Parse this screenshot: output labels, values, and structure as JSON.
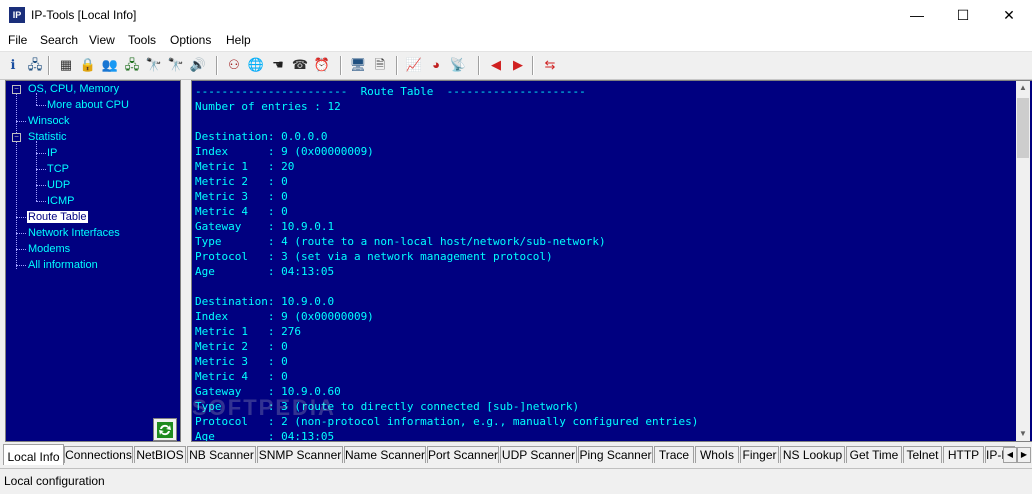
{
  "window": {
    "title": "IP-Tools [Local Info]",
    "icon_text": "IP",
    "minimize_icon": "—",
    "maximize_icon": "☐",
    "close_icon": "✕"
  },
  "menu": [
    "File",
    "Search",
    "View",
    "Tools",
    "Options",
    "Help"
  ],
  "toolbar": {
    "icons": [
      {
        "name": "info-icon",
        "glyph": "ℹ",
        "color": "#1a4ea0"
      },
      {
        "name": "computer-network-icon",
        "glyph": "🖧",
        "color": "#205080"
      },
      {
        "name": "calculator-icon",
        "glyph": "▦",
        "color": "#303030"
      },
      {
        "name": "lock-icon",
        "glyph": "🔒",
        "color": "#806000"
      },
      {
        "name": "users-icon",
        "glyph": "👥",
        "color": "#205080"
      },
      {
        "name": "network-tree-icon",
        "glyph": "🖧",
        "color": "#207020"
      },
      {
        "name": "binoculars-icon",
        "glyph": "🔭",
        "color": "#202020"
      },
      {
        "name": "binoculars-blue-icon",
        "glyph": "🔭",
        "color": "#2030a0"
      },
      {
        "name": "speaker-icon",
        "glyph": "🔊",
        "color": "#806000"
      },
      {
        "name": "network-people-icon",
        "glyph": "⚇",
        "color": "#a02020"
      },
      {
        "name": "globe-icon",
        "glyph": "🌐",
        "color": "#207050"
      },
      {
        "name": "finger-icon",
        "glyph": "☚",
        "color": "#202020"
      },
      {
        "name": "phone-icon",
        "glyph": "☎",
        "color": "#303030"
      },
      {
        "name": "alarm-clock-icon",
        "glyph": "⏰",
        "color": "#c02020"
      },
      {
        "name": "monitor-icon",
        "glyph": "🖥",
        "color": "#205080"
      },
      {
        "name": "document-icon",
        "glyph": "🗎",
        "color": "#404040"
      },
      {
        "name": "chart-icon",
        "glyph": "📈",
        "color": "#a02060"
      },
      {
        "name": "pie-chart-icon",
        "glyph": "◕",
        "color": "#c02020"
      },
      {
        "name": "satellite-dish-icon",
        "glyph": "📡",
        "color": "#606060"
      },
      {
        "name": "arrow-left-icon",
        "glyph": "◀",
        "color": "#d02020"
      },
      {
        "name": "arrow-right-icon",
        "glyph": "▶",
        "color": "#d02020"
      },
      {
        "name": "arrows-swap-icon",
        "glyph": "⇆",
        "color": "#d02020"
      }
    ]
  },
  "tree": [
    {
      "label": "OS, CPU, Memory",
      "expander": "−"
    },
    {
      "label": "More about CPU"
    },
    {
      "label": "Winsock"
    },
    {
      "label": "Statistic",
      "expander": "−"
    },
    {
      "label": "IP"
    },
    {
      "label": "TCP"
    },
    {
      "label": "UDP"
    },
    {
      "label": "ICMP"
    },
    {
      "label": "Route Table",
      "selected": true
    },
    {
      "label": "Network Interfaces"
    },
    {
      "label": "Modems"
    },
    {
      "label": "All information"
    }
  ],
  "content_lines": [
    "-----------------------  Route Table  ---------------------",
    "Number of entries : 12",
    "",
    "Destination: 0.0.0.0",
    "Index      : 9 (0x00000009)",
    "Metric 1   : 20",
    "Metric 2   : 0",
    "Metric 3   : 0",
    "Metric 4   : 0",
    "Gateway    : 10.9.0.1",
    "Type       : 4 (route to a non-local host/network/sub-network)",
    "Protocol   : 3 (set via a network management protocol)",
    "Age        : 04:13:05",
    "",
    "Destination: 10.9.0.0",
    "Index      : 9 (0x00000009)",
    "Metric 1   : 276",
    "Metric 2   : 0",
    "Metric 3   : 0",
    "Metric 4   : 0",
    "Gateway    : 10.9.0.60",
    "Type       : 3 (route to directly connected [sub-]network)",
    "Protocol   : 2 (non-protocol information, e.g., manually configured entries)",
    "Age        : 04:13:05"
  ],
  "watermark": "SOFTPEDIA",
  "tabs": [
    "Local Info",
    "Connections",
    "NetBIOS",
    "NB Scanner",
    "SNMP Scanner",
    "Name Scanner",
    "Port Scanner",
    "UDP Scanner",
    "Ping Scanner",
    "Trace",
    "WhoIs",
    "Finger",
    "NS Lookup",
    "Get Time",
    "Telnet",
    "HTTP",
    "IP-Mo"
  ],
  "active_tab": "Local Info",
  "status": "Local configuration",
  "colors": {
    "pane_bg": "#000080",
    "text": "#00ffff",
    "selected_bg": "#ffffff"
  }
}
